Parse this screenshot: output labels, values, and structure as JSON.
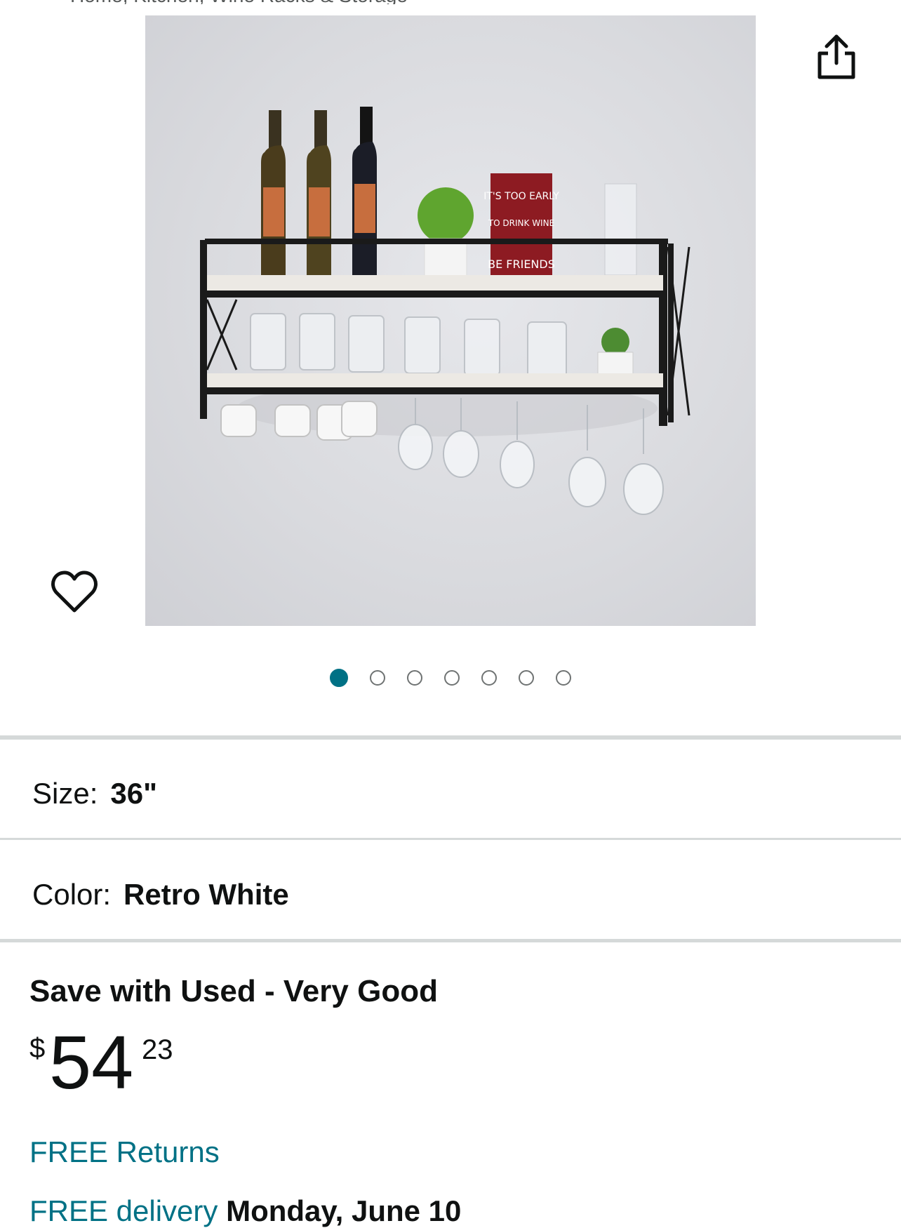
{
  "product": {
    "image_alt": "Wall mounted wine rack shelf with glass holder",
    "image_count": 7,
    "active_image": 1
  },
  "actions": {
    "share_icon": "share-icon",
    "favorite_icon": "heart-icon"
  },
  "variants": {
    "size_label": "Size:",
    "size_value": "36\"",
    "color_label": "Color:",
    "color_value": "Retro White"
  },
  "offer": {
    "heading": "Save with Used - Very Good",
    "price_symbol": "$",
    "price_whole": "54",
    "price_fraction": "23"
  },
  "shipping": {
    "returns_label": "FREE Returns",
    "delivery_label": "FREE delivery",
    "delivery_date": "Monday, June 10"
  },
  "colors": {
    "link": "#007185",
    "active_dot": "#007185",
    "text": "#0f1111",
    "divider": "#d5d9d9"
  }
}
